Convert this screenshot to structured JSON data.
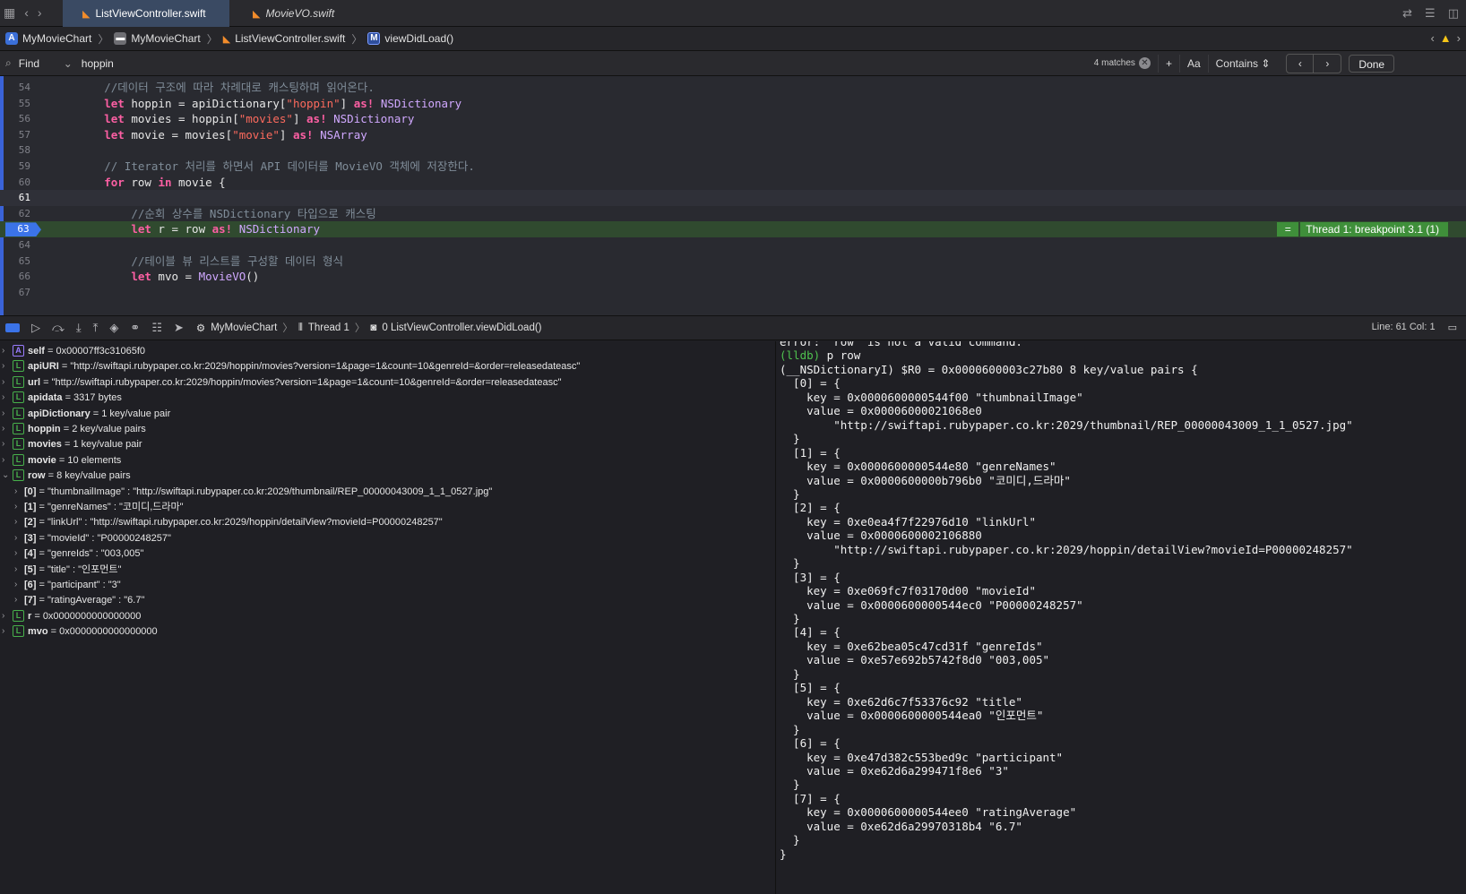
{
  "tabs": [
    {
      "label": "ListViewController.swift",
      "active": true
    },
    {
      "label": "MovieVO.swift",
      "active": false
    }
  ],
  "breadcrumb": [
    "MyMovieChart",
    "MyMovieChart",
    "ListViewController.swift",
    "viewDidLoad()"
  ],
  "find": {
    "mode": "Find",
    "query": "hoppin",
    "matches": "4 matches",
    "case_label": "Aa",
    "match_mode": "Contains",
    "done_label": "Done"
  },
  "editor": {
    "lines": [
      {
        "num": "54",
        "text": "        //데이터 구조에 따라 차례대로 캐스팅하며 읽어온다."
      },
      {
        "num": "55",
        "text": "        let hoppin = apiDictionary[\"hoppin\"] as! NSDictionary"
      },
      {
        "num": "56",
        "text": "        let movies = hoppin[\"movies\"] as! NSDictionary"
      },
      {
        "num": "57",
        "text": "        let movie = movies[\"movie\"] as! NSArray"
      },
      {
        "num": "58",
        "text": ""
      },
      {
        "num": "59",
        "text": "        // Iterator 처리를 하면서 API 데이터를 MovieVO 객체에 저장한다."
      },
      {
        "num": "60",
        "text": "        for row in movie {"
      },
      {
        "num": "61",
        "text": ""
      },
      {
        "num": "62",
        "text": "            //순회 상수를 NSDictionary 타입으로 캐스팅"
      },
      {
        "num": "63",
        "text": "            let r = row as! NSDictionary"
      },
      {
        "num": "64",
        "text": ""
      },
      {
        "num": "65",
        "text": "            //테이블 뷰 리스트를 구성할 데이터 형식"
      },
      {
        "num": "66",
        "text": "            let mvo = MovieVO()"
      },
      {
        "num": "67",
        "text": ""
      }
    ],
    "thread_label": "Thread 1: breakpoint 3.1 (1)",
    "thread_eq": "="
  },
  "debug": {
    "crumbs": [
      "MyMovieChart",
      "Thread 1",
      "0 ListViewController.viewDidLoad()"
    ],
    "line_col": "Line: 61  Col: 1"
  },
  "variables": [
    {
      "badge": "A",
      "name": "self",
      "value": " = 0x00007ff3c31065f0",
      "child": false
    },
    {
      "badge": "L",
      "name": "apiURI",
      "value": " = \"http://swiftapi.rubypaper.co.kr:2029/hoppin/movies?version=1&page=1&count=10&genreId=&order=releasedateasc\"",
      "child": false
    },
    {
      "badge": "L",
      "name": "url",
      "value": " = \"http://swiftapi.rubypaper.co.kr:2029/hoppin/movies?version=1&page=1&count=10&genreId=&order=releasedateasc\"",
      "child": false
    },
    {
      "badge": "L",
      "name": "apidata",
      "value": " = 3317 bytes",
      "child": false
    },
    {
      "badge": "L",
      "name": "apiDictionary",
      "value": " = 1 key/value pair",
      "child": false
    },
    {
      "badge": "L",
      "name": "hoppin",
      "value": " = 2 key/value pairs",
      "child": false
    },
    {
      "badge": "L",
      "name": "movies",
      "value": " = 1 key/value pair",
      "child": false
    },
    {
      "badge": "L",
      "name": "movie",
      "value": " = 10 elements",
      "child": false
    },
    {
      "badge": "L",
      "name": "row",
      "value": " = 8 key/value pairs",
      "child": false
    },
    {
      "badge": "",
      "name": "[0]",
      "value": " = \"thumbnailImage\" : \"http://swiftapi.rubypaper.co.kr:2029/thumbnail/REP_00000043009_1_1_0527.jpg\"",
      "child": true
    },
    {
      "badge": "",
      "name": "[1]",
      "value": " = \"genreNames\" : \"코미디,드라마\"",
      "child": true
    },
    {
      "badge": "",
      "name": "[2]",
      "value": " = \"linkUrl\" : \"http://swiftapi.rubypaper.co.kr:2029/hoppin/detailView?movieId=P00000248257\"",
      "child": true
    },
    {
      "badge": "",
      "name": "[3]",
      "value": " = \"movieId\" : \"P00000248257\"",
      "child": true
    },
    {
      "badge": "",
      "name": "[4]",
      "value": " = \"genreIds\" : \"003,005\"",
      "child": true
    },
    {
      "badge": "",
      "name": "[5]",
      "value": " = \"title\" : \"인포먼트\"",
      "child": true
    },
    {
      "badge": "",
      "name": "[6]",
      "value": " = \"participant\" : \"3\"",
      "child": true
    },
    {
      "badge": "",
      "name": "[7]",
      "value": " = \"ratingAverage\" : \"6.7\"",
      "child": true
    },
    {
      "badge": "L",
      "name": "r",
      "value": " = 0x0000000000000000",
      "child": false
    },
    {
      "badge": "L",
      "name": "mvo",
      "value": " = 0x0000000000000000",
      "child": false
    }
  ],
  "console": [
    "error: 'row' is not a valid command.",
    "(lldb) p row",
    "(__NSDictionaryI) $R0 = 0x0000600003c27b80 8 key/value pairs {",
    "  [0] = {",
    "    key = 0x0000600000544f00 \"thumbnailImage\"",
    "    value = 0x00006000021068e0",
    "        \"http://swiftapi.rubypaper.co.kr:2029/thumbnail/REP_00000043009_1_1_0527.jpg\"",
    "  }",
    "  [1] = {",
    "    key = 0x0000600000544e80 \"genreNames\"",
    "    value = 0x0000600000b796b0 \"코미디,드라마\"",
    "  }",
    "  [2] = {",
    "    key = 0xe0ea4f7f22976d10 \"linkUrl\"",
    "    value = 0x0000600002106880",
    "        \"http://swiftapi.rubypaper.co.kr:2029/hoppin/detailView?movieId=P00000248257\"",
    "  }",
    "  [3] = {",
    "    key = 0xe069fc7f03170d00 \"movieId\"",
    "    value = 0x0000600000544ec0 \"P00000248257\"",
    "  }",
    "  [4] = {",
    "    key = 0xe62bea05c47cd31f \"genreIds\"",
    "    value = 0xe57e692b5742f8d0 \"003,005\"",
    "  }",
    "  [5] = {",
    "    key = 0xe62d6c7f53376c92 \"title\"",
    "    value = 0x0000600000544ea0 \"인포먼트\"",
    "  }",
    "  [6] = {",
    "    key = 0xe47d382c553bed9c \"participant\"",
    "    value = 0xe62d6a299471f8e6 \"3\"",
    "  }",
    "  [7] = {",
    "    key = 0x0000600000544ee0 \"ratingAverage\"",
    "    value = 0xe62d6a29970318b4 \"6.7\"",
    "  }",
    "}"
  ]
}
